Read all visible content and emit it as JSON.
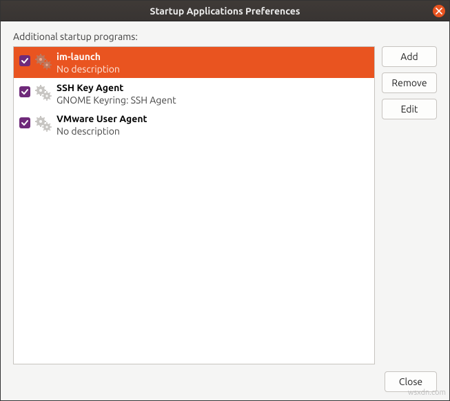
{
  "window": {
    "title": "Startup Applications Preferences"
  },
  "section_label": "Additional startup programs:",
  "buttons": {
    "add": "Add",
    "remove": "Remove",
    "edit": "Edit",
    "close": "Close"
  },
  "items": [
    {
      "name": "im-launch",
      "desc": "No description",
      "checked": true,
      "selected": true
    },
    {
      "name": "SSH Key Agent",
      "desc": "GNOME Keyring: SSH Agent",
      "checked": true,
      "selected": false
    },
    {
      "name": "VMware User Agent",
      "desc": "No description",
      "checked": true,
      "selected": false
    }
  ],
  "watermark": "wsxdn.com"
}
